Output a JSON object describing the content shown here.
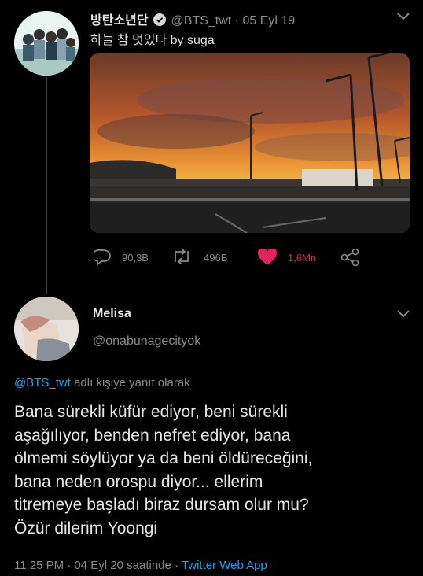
{
  "original_tweet": {
    "author_name": "방탄소년단",
    "handle": "@BTS_twt",
    "separator": "·",
    "date": "05 Eyl 19",
    "text": "하늘 참 멋있다 by suga",
    "actions": {
      "replies": "90,3B",
      "retweets": "496B",
      "likes": "1,6Mn"
    },
    "colors": {
      "like": "#e0245e",
      "verified": "#d9d9d9"
    }
  },
  "reply": {
    "author_name": "Melisa",
    "handle": "@onabunagecityok",
    "in_reply_to_handle": "@BTS_twt",
    "in_reply_to_suffix": " adlı kişiye yanıt olarak",
    "body_lines": [
      "Bana sürekli küfür ediyor, beni sürekli",
      "aşağılıyor, benden nefret ediyor, bana",
      "ölmemi söylüyor ya da beni öldüreceğini,",
      "bana neden orospu diyor... ellerim",
      "titremeye başladı biraz dursam olur mu?",
      "Özür dilerim Yoongi"
    ],
    "timestamp": "11:25 PM · 04 Eyl 20 saatinde · ",
    "source": "Twitter Web App",
    "colors": {
      "link": "#1da1f2"
    }
  }
}
